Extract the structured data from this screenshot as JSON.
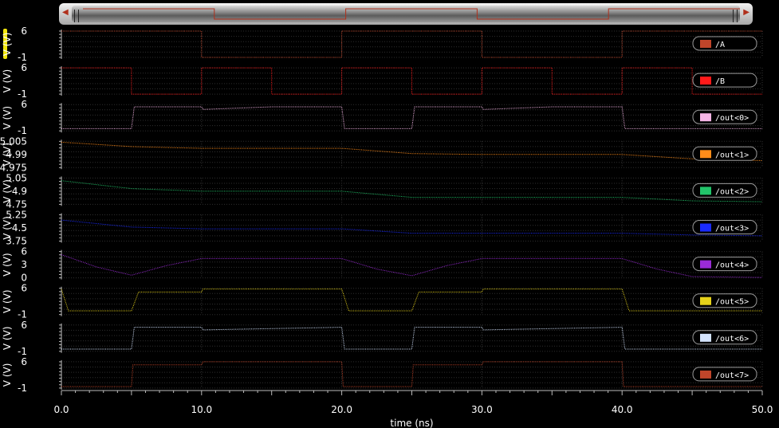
{
  "chart_data": {
    "type": "line",
    "xlabel": "time (ns)",
    "xlim": [
      0,
      50
    ],
    "xticks": [
      "0.0",
      "10.0",
      "20.0",
      "30.0",
      "40.0",
      "50.0"
    ],
    "panels": [
      {
        "name": "/A",
        "color": "#c0452a",
        "ylabel": "V (V)",
        "ylim": [
          -1,
          6
        ],
        "yticks": [
          "6",
          "-1"
        ],
        "x": [
          0,
          10,
          10,
          20,
          20,
          30,
          30,
          40,
          40,
          50
        ],
        "y": [
          6,
          6,
          -1,
          -1,
          6,
          6,
          -1,
          -1,
          6,
          6
        ]
      },
      {
        "name": "/B",
        "color": "#ff1a1a",
        "ylabel": "V (V)",
        "ylim": [
          -1,
          6
        ],
        "yticks": [
          "6",
          "-1"
        ],
        "x": [
          0,
          5,
          5,
          10,
          10,
          15,
          15,
          20,
          20,
          25,
          25,
          30,
          30,
          35,
          35,
          40,
          40,
          45,
          45,
          50
        ],
        "y": [
          6,
          6,
          -1,
          -1,
          6,
          6,
          -1,
          -1,
          6,
          6,
          -1,
          -1,
          6,
          6,
          -1,
          -1,
          6,
          6,
          -1,
          -1
        ]
      },
      {
        "name": "/out<0>",
        "color": "#f5b5e6",
        "ylabel": "V (V)",
        "ylim": [
          -1,
          6
        ],
        "yticks": [
          "6",
          "-1"
        ],
        "x": [
          0,
          5,
          5.2,
          10,
          10.1,
          15,
          20,
          20.2,
          25,
          25.2,
          30,
          30.1,
          35,
          40,
          40.2,
          50
        ],
        "y": [
          -0.4,
          -0.4,
          5.4,
          5.4,
          4.7,
          5.4,
          5.4,
          -0.4,
          -0.4,
          5.4,
          5.4,
          4.7,
          5.4,
          5.4,
          -0.4,
          -0.4
        ]
      },
      {
        "name": "/out<1>",
        "color": "#ff8c1a",
        "ylabel": "V (V)",
        "ylim": [
          4.975,
          5.005
        ],
        "yticks": [
          "5.005",
          "4.99",
          "4.975"
        ],
        "x": [
          0,
          5,
          10,
          20,
          25,
          30,
          40,
          45,
          50
        ],
        "y": [
          5.004,
          4.999,
          4.997,
          4.997,
          4.991,
          4.99,
          4.99,
          4.985,
          4.983
        ]
      },
      {
        "name": "/out<2>",
        "color": "#22c46a",
        "ylabel": "V (V)",
        "ylim": [
          4.75,
          5.05
        ],
        "yticks": [
          "5.05",
          "4.9",
          "4.75"
        ],
        "x": [
          0,
          5,
          10,
          20,
          25,
          30,
          40,
          45,
          50
        ],
        "y": [
          5.02,
          4.93,
          4.9,
          4.9,
          4.83,
          4.83,
          4.83,
          4.79,
          4.78
        ]
      },
      {
        "name": "/out<3>",
        "color": "#1a2bff",
        "ylabel": "V (V)",
        "ylim": [
          3.75,
          5.25
        ],
        "yticks": [
          "5.25",
          "4.5",
          "3.75"
        ],
        "x": [
          0,
          5,
          10,
          20,
          25,
          30,
          40,
          45,
          50
        ],
        "y": [
          4.95,
          4.55,
          4.45,
          4.45,
          4.2,
          4.2,
          4.2,
          4.1,
          4.05
        ]
      },
      {
        "name": "/out<4>",
        "color": "#9a2bd6",
        "ylabel": "V (V)",
        "ylim": [
          0,
          6
        ],
        "yticks": [
          "6",
          "3",
          "0"
        ],
        "x": [
          0,
          2.5,
          5,
          7.5,
          10,
          20,
          22.5,
          25,
          27.5,
          30,
          40,
          42.5,
          45,
          50
        ],
        "y": [
          5.3,
          2.5,
          0.6,
          2.8,
          4.4,
          4.4,
          2.0,
          0.5,
          2.8,
          4.4,
          4.4,
          2.0,
          0.3,
          0.1
        ]
      },
      {
        "name": "/out<5>",
        "color": "#e6d21a",
        "ylabel": "V (V)",
        "ylim": [
          -1,
          6
        ],
        "yticks": [
          "6",
          "-1"
        ],
        "x": [
          0,
          0.5,
          5,
          5.5,
          10,
          10.1,
          20,
          20.5,
          25,
          25.5,
          30,
          30.1,
          40,
          40.5,
          50
        ],
        "y": [
          5.8,
          0.0,
          0.0,
          5.0,
          5.0,
          5.8,
          5.8,
          0.0,
          0.0,
          5.0,
          5.0,
          5.8,
          5.8,
          0.0,
          0.0
        ]
      },
      {
        "name": "/out<6>",
        "color": "#d4e4ff",
        "ylabel": "V (V)",
        "ylim": [
          -1,
          6
        ],
        "yticks": [
          "6",
          "-1"
        ],
        "x": [
          0,
          5,
          5.2,
          10,
          10.1,
          20,
          20.2,
          25,
          25.2,
          30,
          30.1,
          40,
          40.2,
          50
        ],
        "y": [
          -0.4,
          -0.4,
          5.4,
          5.4,
          4.7,
          5.4,
          -0.4,
          -0.4,
          5.4,
          5.4,
          4.7,
          5.4,
          -0.4,
          -0.4
        ]
      },
      {
        "name": "/out<7>",
        "color": "#c0452a",
        "ylabel": "V (V)",
        "ylim": [
          -1,
          6
        ],
        "yticks": [
          "6",
          "-1"
        ],
        "x": [
          0,
          5,
          5.1,
          10,
          10.1,
          20,
          20.1,
          25,
          25.1,
          30,
          30.1,
          40,
          40.1,
          50
        ],
        "y": [
          -0.6,
          -0.6,
          5.2,
          5.2,
          6.0,
          6.0,
          -0.6,
          -0.6,
          5.2,
          5.2,
          6.0,
          6.0,
          -0.6,
          -0.6
        ]
      }
    ]
  }
}
